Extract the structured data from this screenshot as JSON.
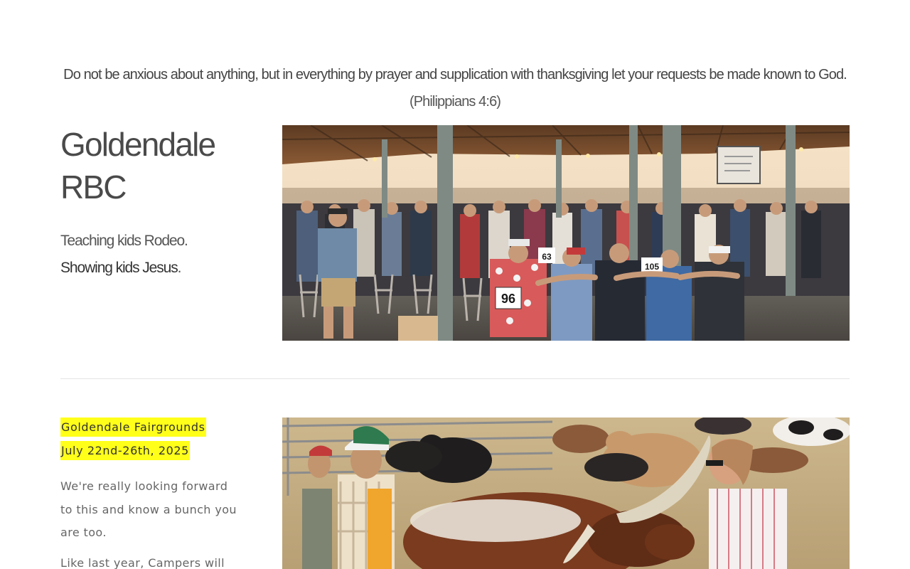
{
  "verse": {
    "text": "Do not be anxious about anything, but in everything by prayer and supplication with thanksgiving let your requests be made known to God.",
    "reference": "(Philippians 4:6)"
  },
  "hero": {
    "title": "Goldendale RBC",
    "tagline_1": "Teaching kids Rodeo.",
    "tagline_2": "Showing kids Jesus",
    "tagline_2_end": ".",
    "photo": {
      "signs": [
        "96",
        "63",
        "105"
      ]
    }
  },
  "event": {
    "location": "Goldendale Fairgrounds",
    "dates": "July 22nd-26th, 2025",
    "paragraph_1": "We're really looking forward to this and know a bunch you are too.",
    "paragraph_2": "Like last year, Campers will"
  },
  "colors": {
    "highlight": "#ffff1a",
    "text": "#4a4a4a",
    "divider": "#e4e4e4"
  }
}
